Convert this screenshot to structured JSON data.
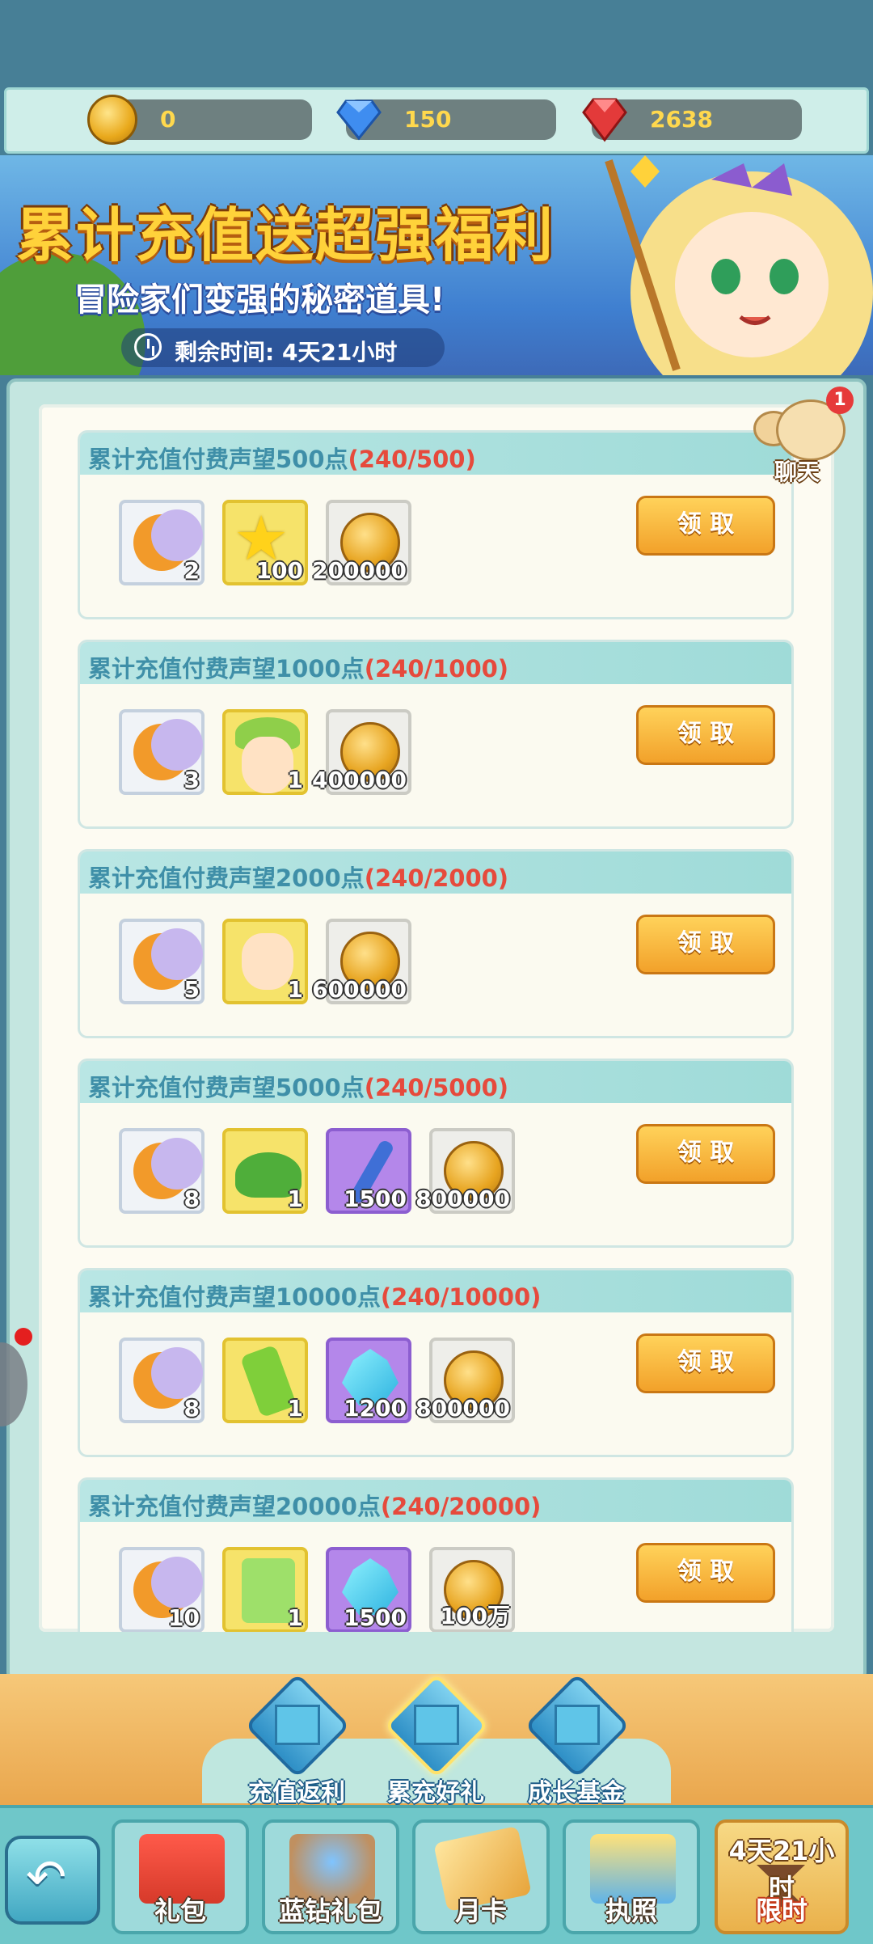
{
  "currency": {
    "gold": {
      "value": "0",
      "icon": "gold-coin-icon"
    },
    "diamond": {
      "value": "150",
      "icon": "blue-diamond-icon"
    },
    "ruby": {
      "value": "2638",
      "icon": "red-gem-icon"
    }
  },
  "banner": {
    "title": "累计充值送超强福利",
    "subtitle": "冒险家们变强的秘密道具!",
    "timer": "剩余时间: 4天21小时"
  },
  "chat": {
    "badge": "1",
    "label": "聊天"
  },
  "tiers": [
    {
      "title": "累计充值付费声望500点",
      "progress": "(240/500)",
      "claim": "领 取",
      "rewards": [
        {
          "icon": "moon-shard-icon",
          "qty": "2",
          "frame": "white"
        },
        {
          "icon": "star-icon",
          "qty": "100",
          "frame": "yellow"
        },
        {
          "icon": "gold-coin-icon",
          "qty": "200000",
          "frame": "grey"
        }
      ]
    },
    {
      "title": "累计充值付费声望1000点",
      "progress": "(240/1000)",
      "claim": "领 取",
      "rewards": [
        {
          "icon": "moon-shard-icon",
          "qty": "3",
          "frame": "white"
        },
        {
          "icon": "character-icon",
          "qty": "1",
          "frame": "yellow"
        },
        {
          "icon": "gold-coin-icon",
          "qty": "400000",
          "frame": "grey"
        }
      ]
    },
    {
      "title": "累计充值付费声望2000点",
      "progress": "(240/2000)",
      "claim": "领 取",
      "rewards": [
        {
          "icon": "moon-shard-icon",
          "qty": "5",
          "frame": "white"
        },
        {
          "icon": "face-icon",
          "qty": "1",
          "frame": "yellow"
        },
        {
          "icon": "gold-coin-icon",
          "qty": "600000",
          "frame": "grey"
        }
      ]
    },
    {
      "title": "累计充值付费声望5000点",
      "progress": "(240/5000)",
      "claim": "领 取",
      "rewards": [
        {
          "icon": "moon-shard-icon",
          "qty": "8",
          "frame": "white"
        },
        {
          "icon": "dino-hat-icon",
          "qty": "1",
          "frame": "yellow"
        },
        {
          "icon": "magic-wand-icon",
          "qty": "1500",
          "frame": "purple"
        },
        {
          "icon": "gold-coin-icon",
          "qty": "800000",
          "frame": "grey"
        }
      ]
    },
    {
      "title": "累计充值付费声望10000点",
      "progress": "(240/10000)",
      "claim": "领 取",
      "rewards": [
        {
          "icon": "moon-shard-icon",
          "qty": "8",
          "frame": "white"
        },
        {
          "icon": "green-scroll-icon",
          "qty": "1",
          "frame": "yellow"
        },
        {
          "icon": "crystal-icon",
          "qty": "1200",
          "frame": "purple"
        },
        {
          "icon": "gold-coin-icon",
          "qty": "800000",
          "frame": "grey"
        }
      ]
    },
    {
      "title": "累计充值付费声望20000点",
      "progress": "(240/20000)",
      "claim": "领 取",
      "rewards": [
        {
          "icon": "moon-shard-icon",
          "qty": "10",
          "frame": "white"
        },
        {
          "icon": "green-outfit-icon",
          "qty": "1",
          "frame": "yellow"
        },
        {
          "icon": "crystal-icon",
          "qty": "1500",
          "frame": "purple"
        },
        {
          "icon": "gold-coin-icon",
          "qty": "100万",
          "frame": "grey"
        }
      ]
    }
  ],
  "subtabs": [
    {
      "label": "充值返利",
      "active": false
    },
    {
      "label": "累充好礼",
      "active": true
    },
    {
      "label": "成长基金",
      "active": false
    }
  ],
  "bottom_nav": {
    "back_icon": "back-arrow-icon",
    "items": [
      {
        "label": "礼包",
        "icon": "gift-box-icon"
      },
      {
        "label": "蓝钻礼包",
        "icon": "diamond-sack-icon"
      },
      {
        "label": "月卡",
        "icon": "month-card-icon"
      },
      {
        "label": "执照",
        "icon": "license-icon"
      }
    ],
    "limited": {
      "timer": "4天21小时",
      "label": "限时",
      "icon": "hourglass-icon"
    }
  },
  "colors": {
    "progress_red": "#e64a3c",
    "title_teal": "#3f8fa8",
    "claim_orange": "#f2a12a"
  }
}
